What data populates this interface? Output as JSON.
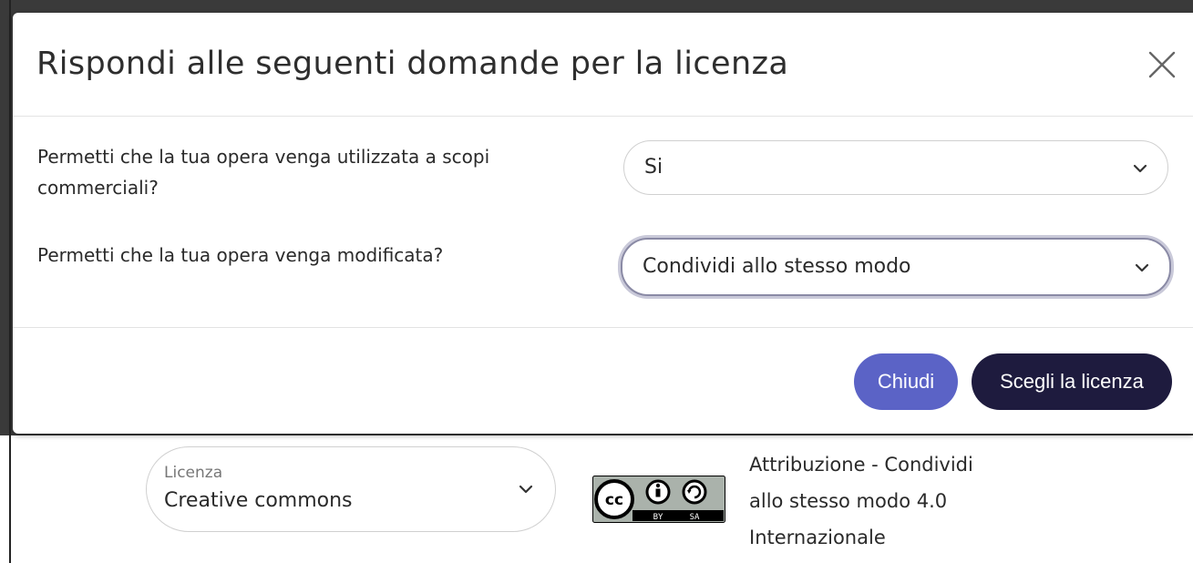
{
  "modal": {
    "title": "Rispondi alle seguenti domande per la licenza",
    "questions": [
      {
        "label": "Permetti che la tua opera venga utilizzata a scopi commerciali?",
        "selected": "Si"
      },
      {
        "label": "Permetti che la tua opera venga modificata?",
        "selected": "Condividi allo stesso modo"
      }
    ],
    "buttons": {
      "close_label": "Chiudi",
      "choose_label": "Scegli la licenza"
    }
  },
  "license": {
    "field_label": "Licenza",
    "field_value": "Creative commons",
    "badge_text_by": "BY",
    "badge_text_sa": "SA",
    "badge_text_cc": "cc",
    "description_lines": [
      "Attribuzione - Condividi",
      "allo stesso modo 4.0",
      "Internazionale"
    ]
  },
  "colors": {
    "primary_button": "#5b63c6",
    "dark_button": "#1e1b3e"
  }
}
